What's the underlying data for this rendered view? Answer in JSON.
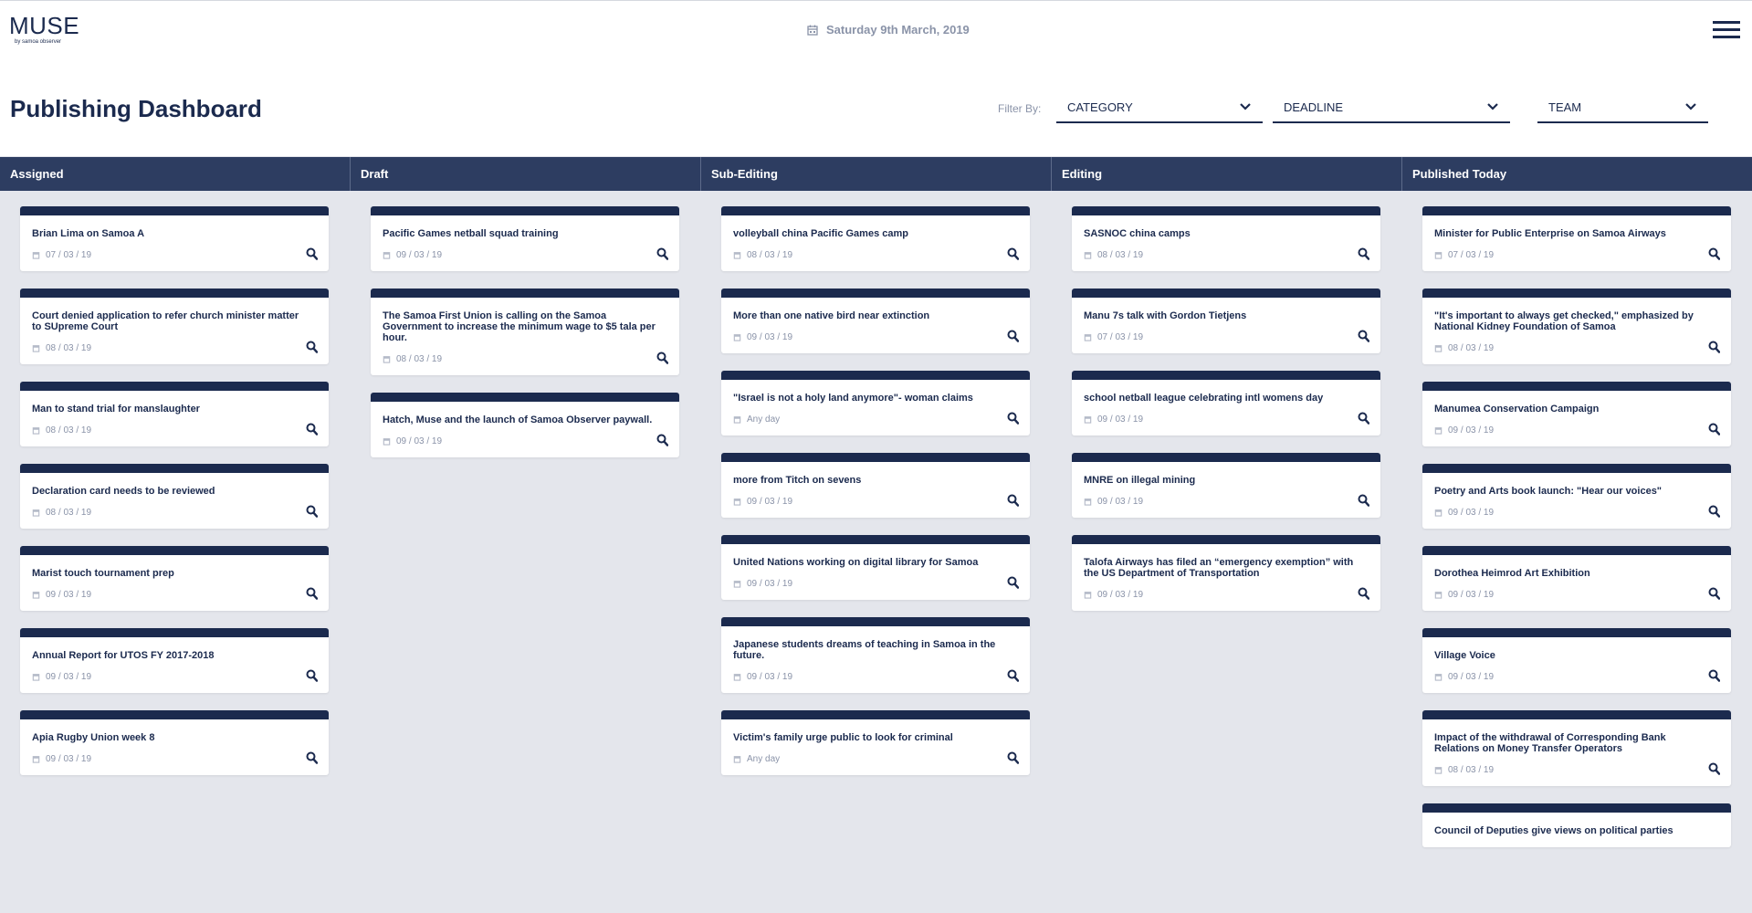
{
  "header": {
    "logo": "MUSE",
    "logo_sub": "by samoa observer",
    "date": "Saturday 9th March, 2019",
    "menu_icon": "hamburger-menu-icon"
  },
  "dashboard": {
    "title": "Publishing Dashboard",
    "filter_label": "Filter By:",
    "filters": [
      "CATEGORY",
      "DEADLINE",
      "TEAM"
    ]
  },
  "columns": [
    {
      "name": "Assigned",
      "cards": [
        {
          "title": "Brian Lima on Samoa A",
          "date": "07 / 03 / 19"
        },
        {
          "title": "Court denied application to refer church minister matter to SUpreme Court",
          "date": "08 / 03 / 19"
        },
        {
          "title": "Man to stand trial for manslaughter",
          "date": "08 / 03 / 19"
        },
        {
          "title": "Declaration card needs to be reviewed",
          "date": "08 / 03 / 19"
        },
        {
          "title": "Marist touch tournament prep",
          "date": "09 / 03 / 19"
        },
        {
          "title": "Annual Report for UTOS FY 2017-2018",
          "date": "09 / 03 / 19"
        },
        {
          "title": "Apia Rugby Union week 8",
          "date": "09 / 03 / 19"
        }
      ]
    },
    {
      "name": "Draft",
      "cards": [
        {
          "title": "Pacific Games netball squad training",
          "date": "09 / 03 / 19"
        },
        {
          "title": "The Samoa First Union is calling on the Samoa Government to increase the minimum wage to $5 tala per hour.",
          "date": "08 / 03 / 19"
        },
        {
          "title": "Hatch, Muse and the launch of Samoa Observer paywall.",
          "date": "09 / 03 / 19"
        }
      ]
    },
    {
      "name": "Sub-Editing",
      "cards": [
        {
          "title": "volleyball china Pacific Games camp",
          "date": "08 / 03 / 19"
        },
        {
          "title": "More than one native bird near extinction",
          "date": "09 / 03 / 19"
        },
        {
          "title": "\"Israel is not a holy land anymore\"- woman claims",
          "date": "Any day"
        },
        {
          "title": "more from Titch on sevens",
          "date": "09 / 03 / 19"
        },
        {
          "title": "United Nations working on digital library for Samoa",
          "date": "09 / 03 / 19"
        },
        {
          "title": "Japanese students dreams of teaching in Samoa in the future.",
          "date": "09 / 03 / 19"
        },
        {
          "title": "Victim's family urge public to look for criminal",
          "date": "Any day"
        }
      ]
    },
    {
      "name": "Editing",
      "cards": [
        {
          "title": "SASNOC china camps",
          "date": "08 / 03 / 19"
        },
        {
          "title": "Manu 7s talk with Gordon Tietjens",
          "date": "07 / 03 / 19"
        },
        {
          "title": "school netball league celebrating intl womens day",
          "date": "09 / 03 / 19"
        },
        {
          "title": "MNRE on illegal mining",
          "date": "09 / 03 / 19"
        },
        {
          "title": "Talofa Airways has filed an “emergency exemption” with the US Department of Transportation",
          "date": "09 / 03 / 19"
        }
      ]
    },
    {
      "name": "Published Today",
      "cards": [
        {
          "title": "Minister for Public Enterprise on Samoa Airways",
          "date": "07 / 03 / 19"
        },
        {
          "title": "\"It's important to always get checked,\" emphasized by National Kidney Foundation of Samoa",
          "date": "08 / 03 / 19"
        },
        {
          "title": "Manumea Conservation Campaign",
          "date": "09 / 03 / 19"
        },
        {
          "title": "Poetry and Arts book launch: \"Hear our voices\"",
          "date": "09 / 03 / 19"
        },
        {
          "title": "Dorothea Heimrod Art Exhibition",
          "date": "09 / 03 / 19"
        },
        {
          "title": "Village Voice",
          "date": "09 / 03 / 19"
        },
        {
          "title": "Impact of the withdrawal of Corresponding Bank Relations on Money Transfer Operators",
          "date": "08 / 03 / 19"
        },
        {
          "title": "Council of Deputies give views on political parties",
          "date": ""
        }
      ]
    }
  ]
}
